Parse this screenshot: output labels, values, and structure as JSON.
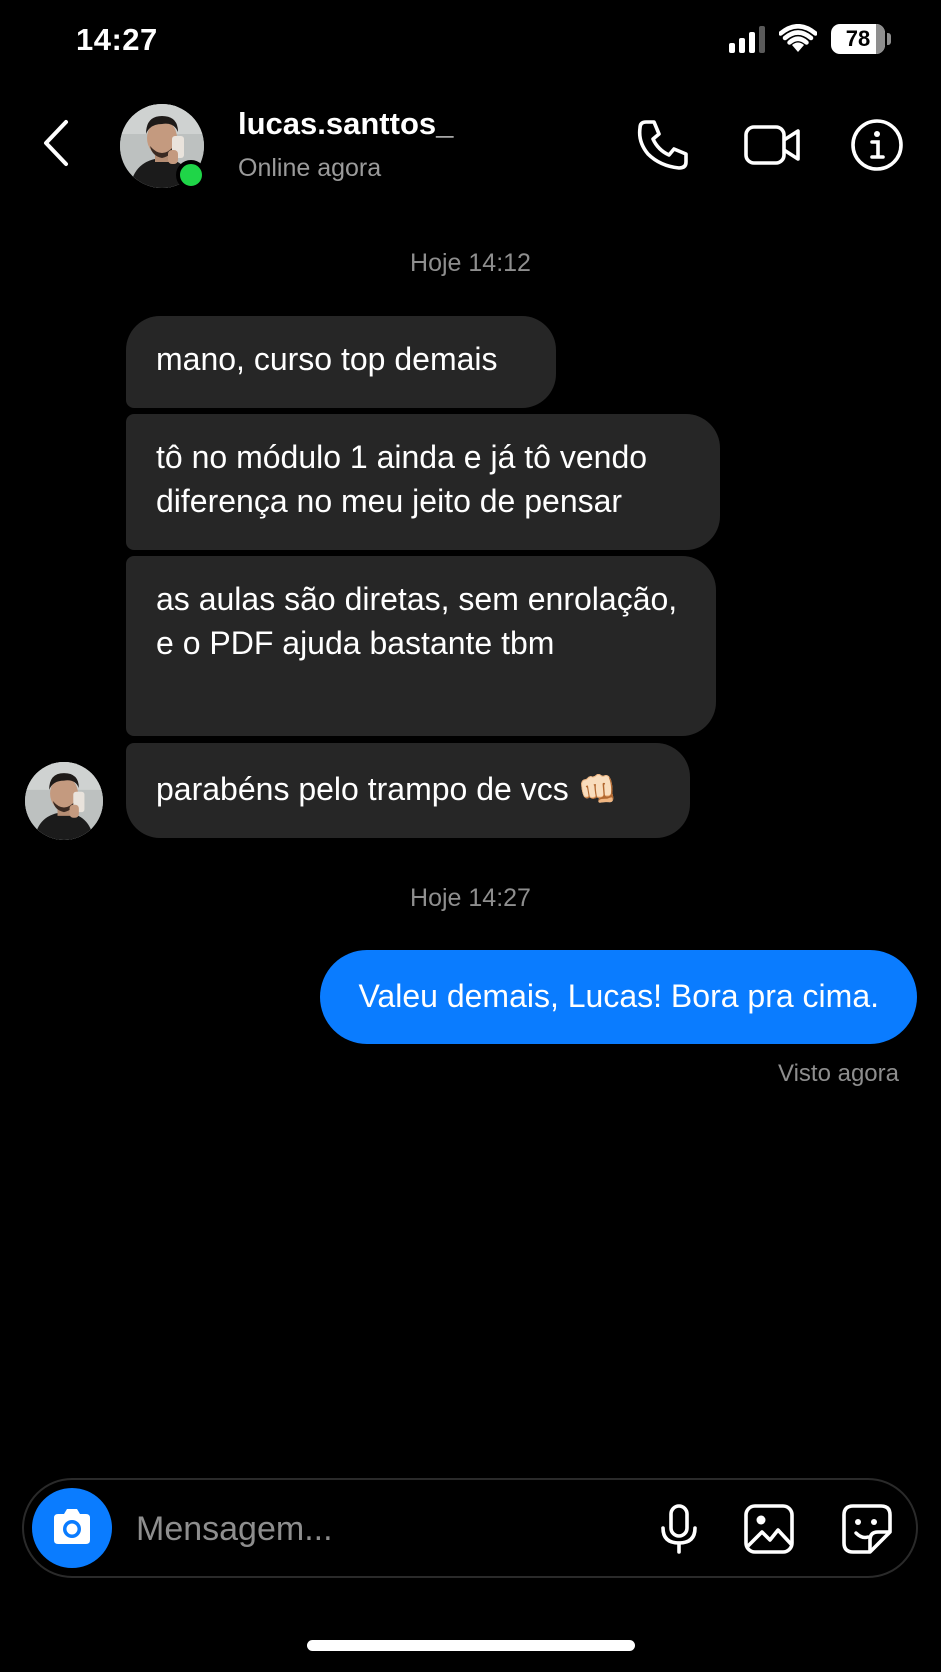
{
  "status_bar": {
    "time": "14:27",
    "battery": "78"
  },
  "header": {
    "username": "lucas.santtos_",
    "status": "Online agora"
  },
  "conversation": {
    "timestamp_1": "Hoje 14:12",
    "received": [
      "mano, curso top demais",
      "tô no módulo 1 ainda e já tô vendo diferença no meu jeito de pensar",
      "as aulas são diretas, sem enrolação, e o PDF ajuda bastante tbm",
      "parabéns pelo trampo de vcs 👊🏻"
    ],
    "timestamp_2": "Hoje 14:27",
    "sent": [
      "Valeu demais, Lucas! Bora pra cima."
    ],
    "seen_label": "Visto agora"
  },
  "composer": {
    "placeholder": "Mensagem..."
  },
  "colors": {
    "background": "#000000",
    "received_bubble": "#262626",
    "sent_bubble": "#0a7cff",
    "online_indicator": "#1fd548",
    "secondary_text": "#8e8e8e"
  },
  "icons": {
    "back": "chevron-left-icon",
    "call": "phone-icon",
    "video": "video-camera-icon",
    "info": "info-icon",
    "camera": "camera-icon",
    "mic": "microphone-icon",
    "gallery": "image-icon",
    "sticker": "sticker-icon"
  }
}
